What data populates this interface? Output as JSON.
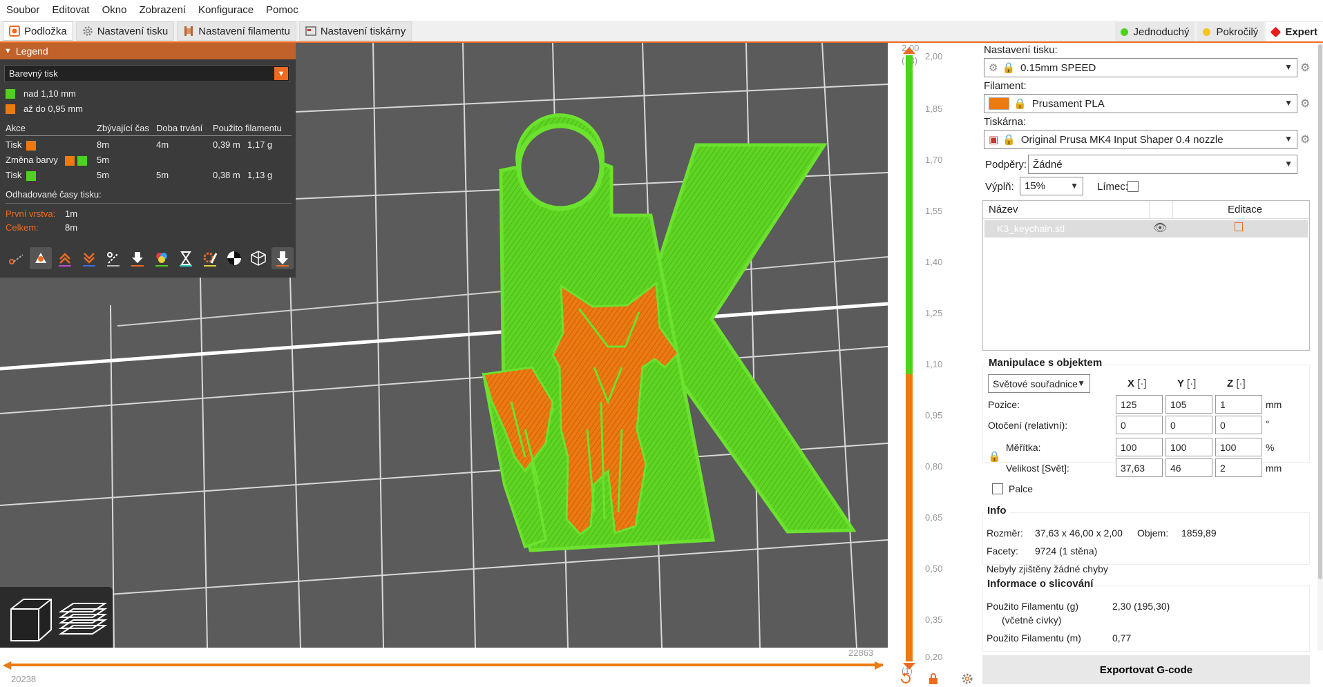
{
  "menu": [
    "Soubor",
    "Editovat",
    "Okno",
    "Zobrazení",
    "Konfigurace",
    "Pomoc"
  ],
  "tabs": [
    {
      "label": "Podložka",
      "icon": "plate-icon",
      "active": true
    },
    {
      "label": "Nastavení tisku",
      "icon": "gear-icon",
      "active": false
    },
    {
      "label": "Nastavení filamentu",
      "icon": "spool-icon",
      "active": false
    },
    {
      "label": "Nastavení tiskárny",
      "icon": "printer-icon",
      "active": false
    }
  ],
  "modes": [
    {
      "label": "Jednoduchý",
      "color": "#4dd21d"
    },
    {
      "label": "Pokročilý",
      "color": "#f5c518"
    },
    {
      "label": "Expert",
      "color": "#e81c1c",
      "active": true
    }
  ],
  "legend": {
    "title": "Legend",
    "view_type": "Barevný tisk",
    "ranges": [
      {
        "label": "nad 1,10 mm",
        "color": "#4dd21d"
      },
      {
        "label": "až do 0,95 mm",
        "color": "#ed7a10"
      }
    ],
    "table_headers": [
      "Akce",
      "Zbývající čas",
      "Doba trvání",
      "Použito filamentu"
    ],
    "rows": [
      {
        "action": "Tisk",
        "remaining": "8m",
        "duration": "4m",
        "length": "0,39 m",
        "weight": "1,17 g"
      },
      {
        "action": "Změna barvy",
        "remaining": "5m",
        "duration": "",
        "length": "",
        "weight": ""
      },
      {
        "action": "Tisk",
        "remaining": "5m",
        "duration": "5m",
        "length": "0,38 m",
        "weight": "1,13 g"
      }
    ],
    "estimated_title": "Odhadované časy tisku:",
    "first_layer_label": "První vrstva:",
    "first_layer_value": "1m",
    "total_label": "Celkem:",
    "total_value": "8m"
  },
  "hslider": {
    "left_value": "20238",
    "right_value": "22863"
  },
  "vslider": {
    "top_value": "2,00",
    "top_layer": "(13)",
    "bottom_value": "0,20",
    "bottom_layer": "(1)",
    "ticks": [
      "2,00",
      "1,85",
      "1,70",
      "1,55",
      "1,40",
      "1,25",
      "1,10",
      "0,95",
      "0,80",
      "0,65",
      "0,50",
      "0,35",
      "0,20"
    ]
  },
  "right": {
    "print_settings_label": "Nastavení tisku:",
    "print_settings_value": "0.15mm SPEED",
    "filament_label": "Filament:",
    "filament_value": "Prusament PLA",
    "filament_color": "#ed7a10",
    "printer_label": "Tiskárna:",
    "printer_value": "Original Prusa MK4 Input Shaper 0.4 nozzle",
    "supports_label": "Podpěry:",
    "supports_value": "Žádné",
    "infill_label": "Výplň:",
    "infill_value": "15%",
    "brim_label": "Límec:",
    "list_header_name": "Název",
    "list_header_edit": "Editace",
    "object_name": "K3_keychain.stl",
    "manip_title": "Manipulace s objektem",
    "coord_system": "Světové souřadnice",
    "axis_x": "X",
    "axis_y": "Y",
    "axis_z": "Z",
    "position_label": "Pozice:",
    "position": [
      "125",
      "105",
      "1"
    ],
    "position_unit": "mm",
    "rotation_label": "Otočení (relativní):",
    "rotation": [
      "0",
      "0",
      "0"
    ],
    "rotation_unit": "°",
    "scale_label": "Měřítka:",
    "scale": [
      "100",
      "100",
      "100"
    ],
    "scale_unit": "%",
    "size_label": "Velikost [Svět]:",
    "size": [
      "37,63",
      "46",
      "2"
    ],
    "size_unit": "mm",
    "inches_label": "Palce",
    "info_title": "Info",
    "size_info_label": "Rozměr:",
    "size_info_value": "37,63 x 46,00 x 2,00",
    "volume_label": "Objem:",
    "volume_value": "1859,89",
    "facets_label": "Facety:",
    "facets_value": "9724 (1 stěna)",
    "errors_text": "Nebyly zjištěny žádné chyby",
    "slice_title": "Informace o slicování",
    "filament_g_label": "Použito Filamentu (g)",
    "filament_g_sub": "(včetně cívky)",
    "filament_g_value": "2,30 (195,30)",
    "filament_m_label": "Použito Filamentu (m)",
    "filament_m_value": "0,77",
    "export_label": "Exportovat G-code"
  },
  "colors": {
    "accent": "#ed6b21",
    "green": "#4dd21d",
    "orange": "#ed7a10",
    "bed": "#5a5a5a"
  }
}
